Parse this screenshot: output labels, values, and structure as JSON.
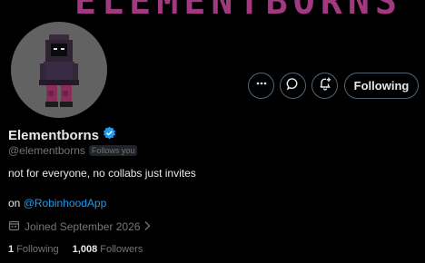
{
  "banner": {
    "text": "ELEMENTBORNS"
  },
  "profile": {
    "display_name": "Elementborns",
    "handle": "@elementborns",
    "follows_you": "Follows you",
    "bio": "not for everyone, no collabs just invites",
    "link_prefix": "on ",
    "link_mention": "@RobinhoodApp",
    "joined": "Joined September 2026"
  },
  "actions": {
    "following_label": "Following"
  },
  "stats": {
    "following_count": "1",
    "following_label": "Following",
    "followers_count": "1,008",
    "followers_label": "Followers"
  },
  "colors": {
    "accent": "#1d9bf0",
    "banner": "#b3408f",
    "avatar_bg": "#626262"
  },
  "icons": [
    "more-icon",
    "message-icon",
    "notify-bell-icon",
    "verified-badge-icon",
    "calendar-icon",
    "chevron-right-icon"
  ]
}
